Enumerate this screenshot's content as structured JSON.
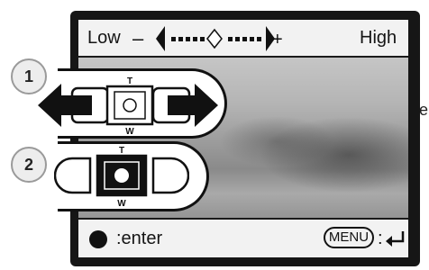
{
  "adjustment_bar": {
    "low_label": "Low",
    "minus_sign": "–",
    "plus_sign": "+",
    "high_label": "High"
  },
  "footer": {
    "enter_label": ":enter",
    "menu_key_label": "MENU",
    "menu_colon": ":"
  },
  "steps": [
    {
      "number": "1",
      "telephoto_label": "T",
      "wide_label": "W"
    },
    {
      "number": "2",
      "telephoto_label": "T",
      "wide_label": "W"
    }
  ],
  "side_fragment": "e",
  "colors": {
    "screen_background": "#161616",
    "bar_background": "#f2f2f2",
    "ink": "#111111"
  }
}
